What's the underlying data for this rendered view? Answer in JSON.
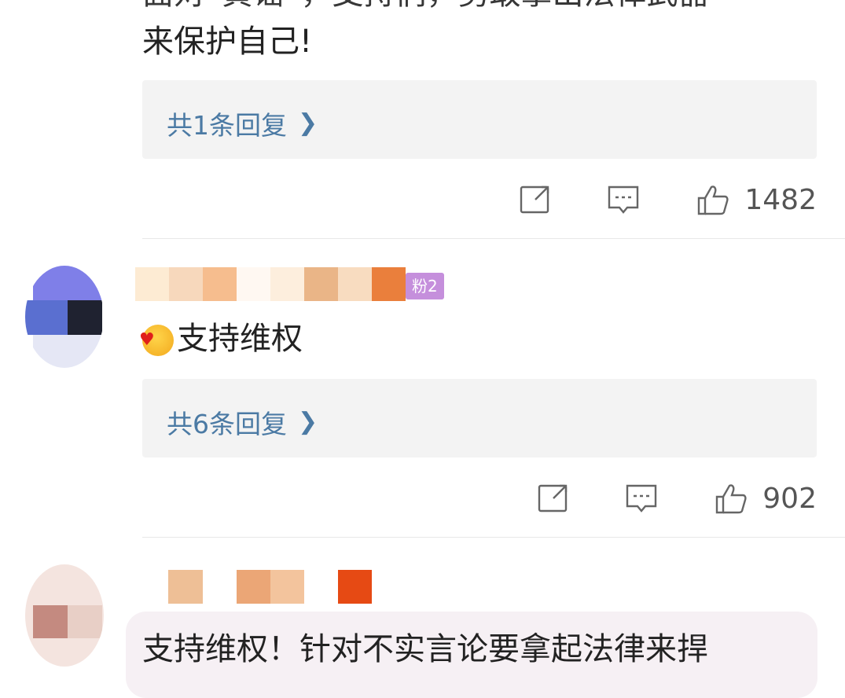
{
  "comment1": {
    "text_partial_top": "面对“黄谣”，支持们，勇敢拿出法律武器",
    "text_line2": "来保护自己!",
    "reply_link": "共1条回复",
    "chevron_icon": "chevron-right-icon",
    "likes": "1482"
  },
  "comment2": {
    "badge": "粉2",
    "text": "支持维权",
    "emoji_icon": "blushing-face-heart-icon",
    "reply_link": "共6条回复",
    "chevron_icon": "chevron-right-icon",
    "likes": "902"
  },
  "comment3": {
    "text": "支持维权！针对不实言论要拿起法律来捍"
  },
  "colors": {
    "link": "#4b7aa4",
    "reply_bg": "#f3f3f3",
    "badge": "#c58fdc"
  }
}
